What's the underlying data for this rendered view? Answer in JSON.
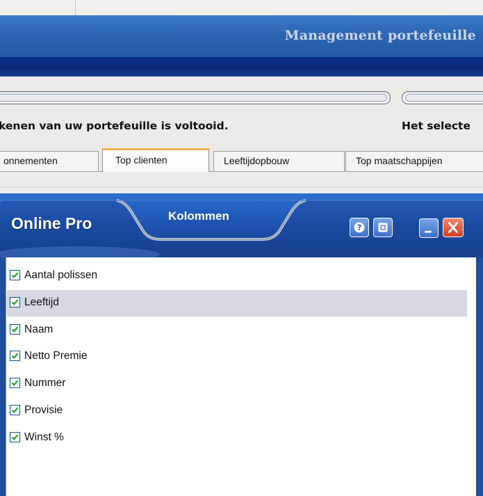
{
  "window": {
    "title": "Management portefeuille"
  },
  "status": {
    "left_text": "kenen van uw portefeuille is voltooid.",
    "right_text": "Het selecte"
  },
  "tabs": [
    {
      "label": "onnementen",
      "active": false
    },
    {
      "label": "Top clienten",
      "active": true
    },
    {
      "label": "Leeftijdopbouw",
      "active": false
    },
    {
      "label": "Top maatschappijen",
      "active": false
    }
  ],
  "panel": {
    "brand": "Online Pro",
    "tab_title": "Kolommen",
    "buttons": [
      {
        "icon": "help-icon"
      },
      {
        "icon": "screen-icon"
      },
      {
        "icon": "minimize-icon"
      },
      {
        "icon": "close-icon"
      }
    ],
    "colors": {
      "header_blue": "#1e55b2",
      "close_red": "#d23d1f",
      "highlight_row": "#d6d9e3",
      "checkmark": "#21a121"
    }
  },
  "columns": [
    {
      "label": "Aantal polissen",
      "checked": true,
      "highlighted": false
    },
    {
      "label": "Leeftijd",
      "checked": true,
      "highlighted": true
    },
    {
      "label": "Naam",
      "checked": true,
      "highlighted": false
    },
    {
      "label": "Netto Premie",
      "checked": true,
      "highlighted": false
    },
    {
      "label": "Nummer",
      "checked": true,
      "highlighted": false
    },
    {
      "label": "Provisie",
      "checked": true,
      "highlighted": false
    },
    {
      "label": "Winst %",
      "checked": true,
      "highlighted": false
    }
  ]
}
